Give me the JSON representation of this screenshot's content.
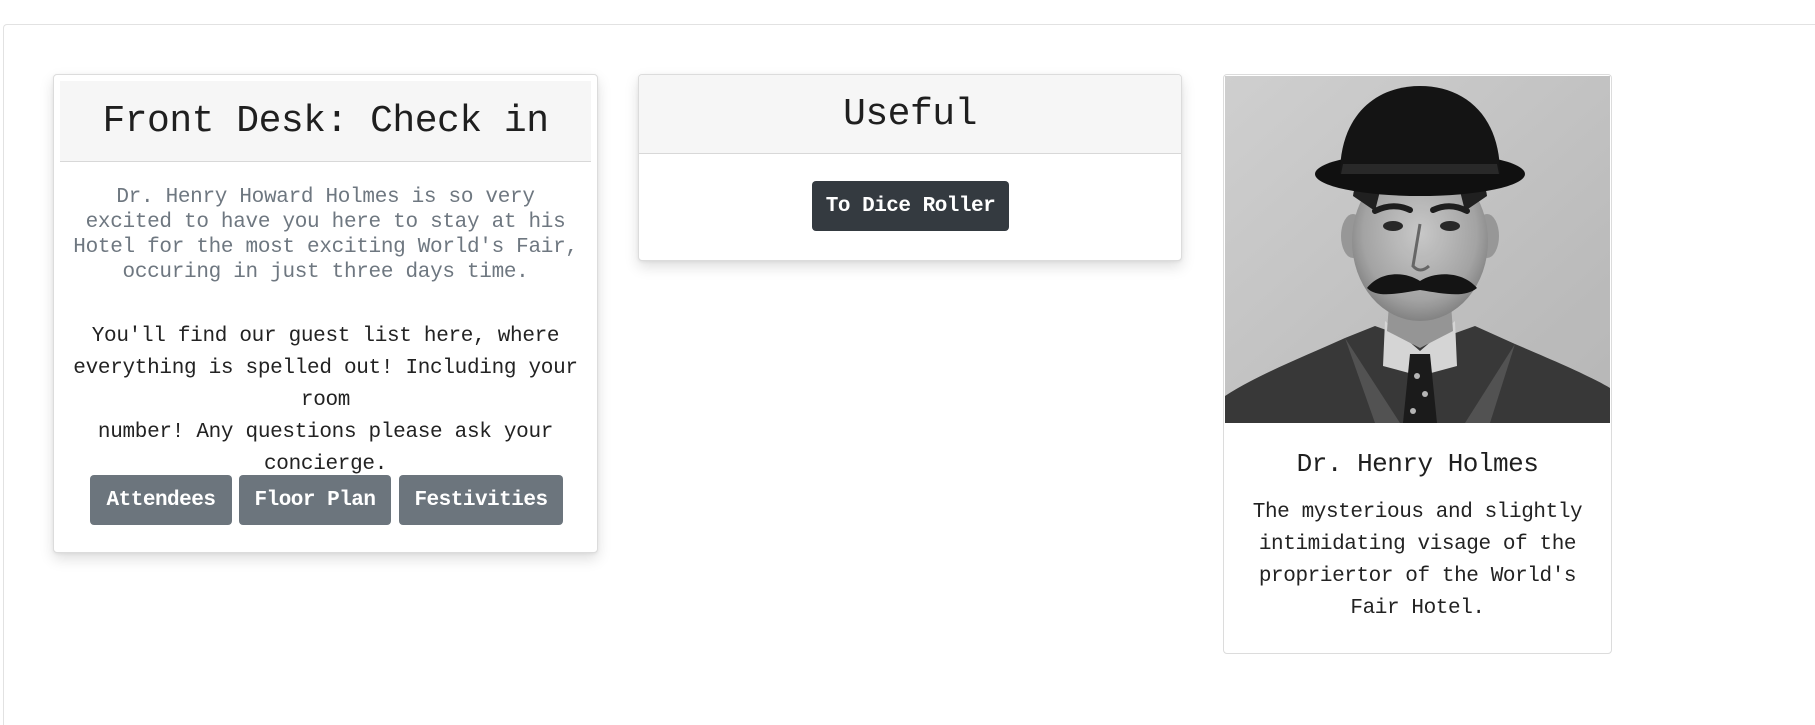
{
  "checkin_card": {
    "title": "Front Desk: Check in",
    "intro_lines": [
      "Dr. Henry Howard Holmes is so very",
      "excited to have you here to stay at his",
      "Hotel for the most exciting World's Fair,",
      "occuring in just three days time."
    ],
    "body_lines": [
      "You'll find our guest list here, where",
      "everything is spelled out! Including your room",
      "number! Any questions please ask your",
      "concierge."
    ],
    "buttons": {
      "attendees": "Attendees",
      "floor_plan": "Floor Plan",
      "festivities": "Festivities"
    },
    "button_color": "#6c757d"
  },
  "useful_card": {
    "title": "Useful",
    "dice_button": "To Dice Roller",
    "button_color": "#343a40"
  },
  "profile_card": {
    "image": "portrait-photo",
    "name": "Dr. Henry Holmes",
    "description_lines": [
      "The mysterious and slightly",
      "intimidating visage of the",
      "propriertor of the World's",
      "Fair Hotel."
    ]
  }
}
